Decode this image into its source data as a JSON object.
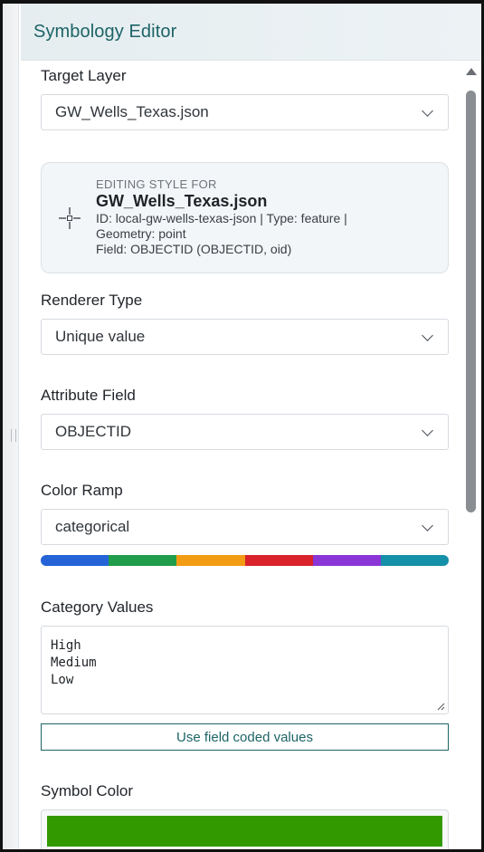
{
  "header": {
    "title": "Symbology Editor"
  },
  "target_layer": {
    "label": "Target Layer",
    "value": "GW_Wells_Texas.json"
  },
  "info_card": {
    "subtitle": "EDITING STYLE FOR",
    "layer_name": "GW_Wells_Texas.json",
    "line1": "ID: local-gw-wells-texas-json | Type: feature |",
    "line2": "Geometry: point",
    "line3": "Field: OBJECTID (OBJECTID, oid)",
    "icon": "crosshair-icon"
  },
  "renderer_type": {
    "label": "Renderer Type",
    "value": "Unique value"
  },
  "attribute_field": {
    "label": "Attribute Field",
    "value": "OBJECTID"
  },
  "color_ramp": {
    "label": "Color Ramp",
    "value": "categorical",
    "colors": [
      "#2563d6",
      "#1f9d4a",
      "#f29c13",
      "#d9222a",
      "#8a36d6",
      "#1490a8"
    ]
  },
  "category_values": {
    "label": "Category Values",
    "lines": [
      "High",
      "Medium",
      "Low"
    ]
  },
  "use_field_button": {
    "label": "Use field coded values"
  },
  "symbol_color": {
    "label": "Symbol Color",
    "color": "#339900"
  },
  "colors": {
    "accent": "#1d6466",
    "header_bg": "#e8eff2"
  }
}
